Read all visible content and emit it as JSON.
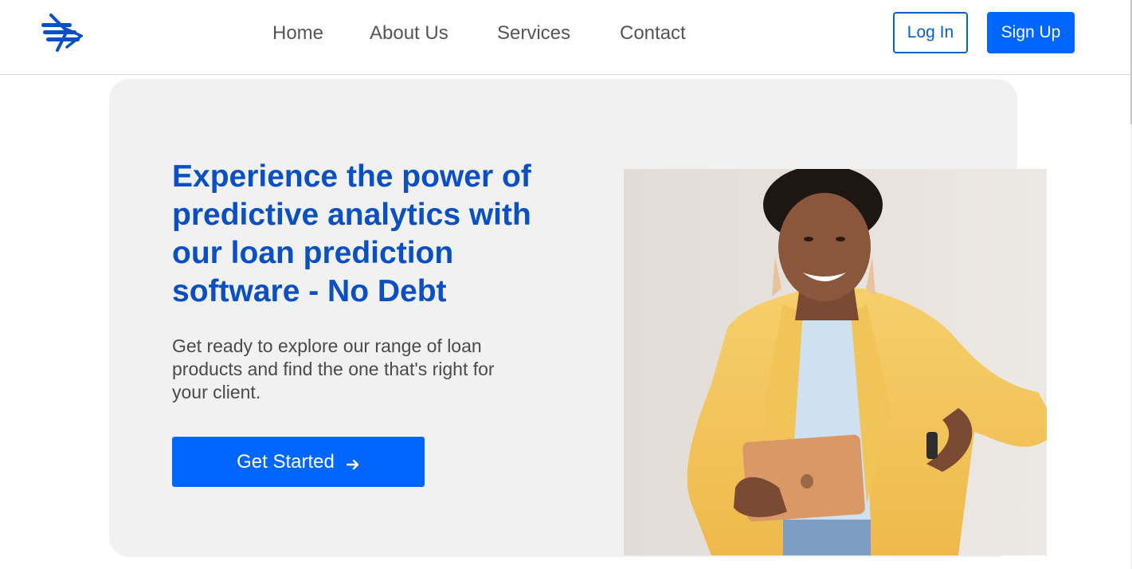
{
  "brand": {
    "logo_icon": "striped-arrow-logo-icon",
    "colors": {
      "primary": "#0066ff",
      "heading": "#0a4fc4",
      "nav_text": "#555555",
      "hero_bg": "#f1f1f1"
    }
  },
  "nav": {
    "items": [
      {
        "label": "Home"
      },
      {
        "label": "About Us"
      },
      {
        "label": "Services"
      },
      {
        "label": "Contact"
      }
    ]
  },
  "auth": {
    "login_label": "Log In",
    "signup_label": "Sign Up"
  },
  "hero": {
    "title": "Experience the power of predictive analytics with our loan prediction software - No Debt",
    "description": "Get ready to explore our range of loan products and find the one that's right for your client.",
    "cta_label": "Get Started",
    "cta_icon": "arrow-right-icon",
    "photo": "woman-holding-tablet-photo"
  }
}
